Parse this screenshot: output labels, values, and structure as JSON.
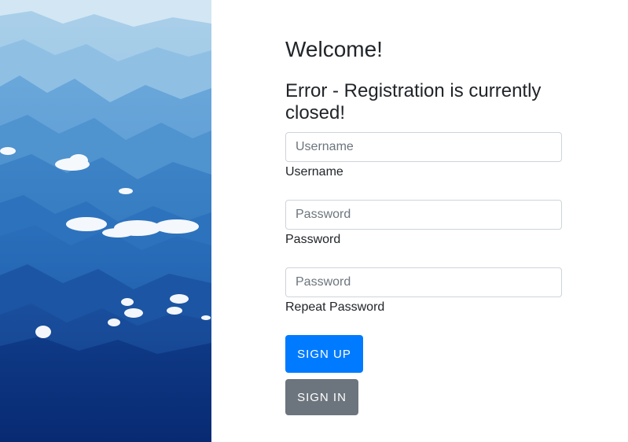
{
  "hero": {
    "image_description_icon": "mountain-landscape"
  },
  "form": {
    "welcome": "Welcome!",
    "error": "Error - Registration is currently closed!",
    "username": {
      "placeholder": "Username",
      "value": "",
      "label": "Username"
    },
    "password": {
      "placeholder": "Password",
      "value": "",
      "label": "Password"
    },
    "repeat_password": {
      "placeholder": "Password",
      "value": "",
      "label": "Repeat Password"
    },
    "sign_up_label": "SIGN UP",
    "sign_in_label": "SIGN IN"
  },
  "colors": {
    "primary": "#007bff",
    "secondary": "#6c757d",
    "text": "#212529",
    "border": "#ced4da"
  }
}
